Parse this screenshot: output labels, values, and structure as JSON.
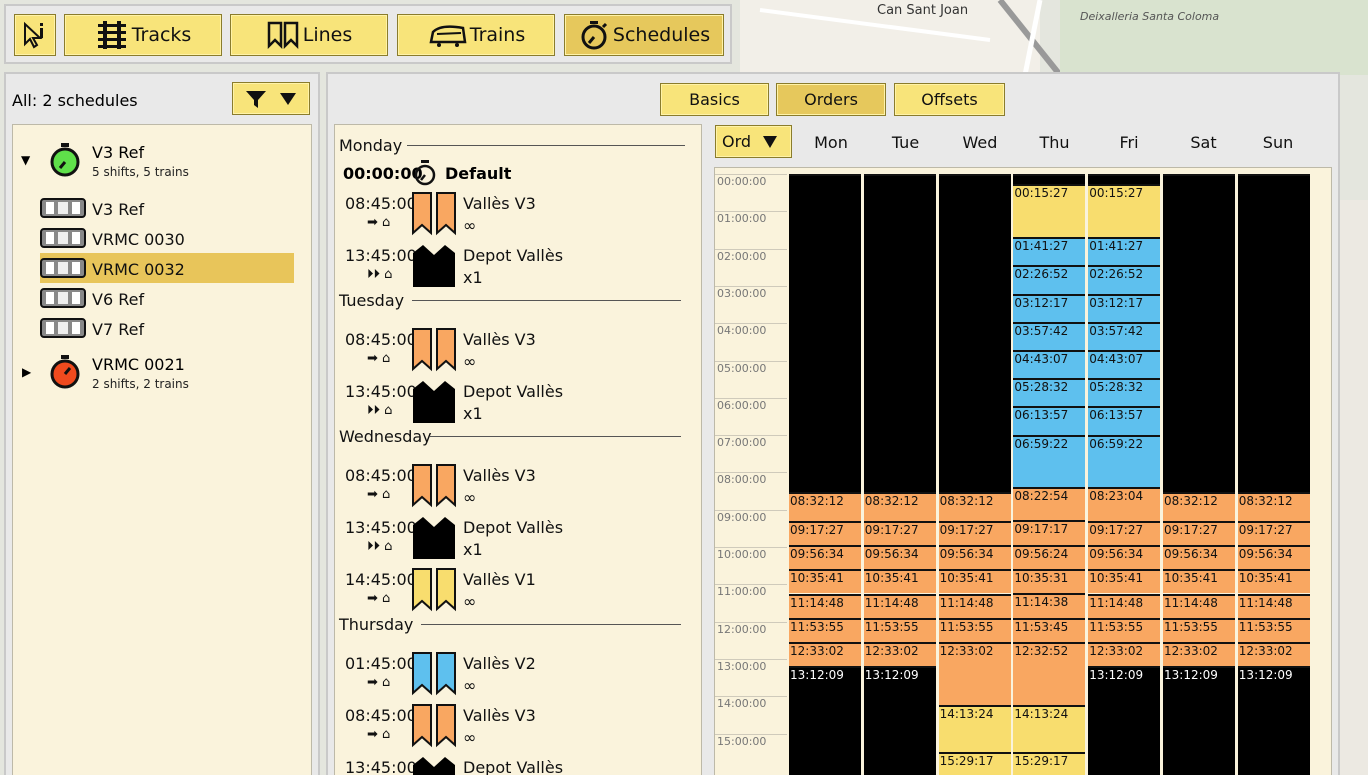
{
  "map": {
    "labels": [
      "Can Sant Joan",
      "Deixalleria Santa Coloma"
    ]
  },
  "toolbar": {
    "tabs": [
      {
        "label": "Tracks",
        "icon": "tracks-icon"
      },
      {
        "label": "Lines",
        "icon": "lines-icon"
      },
      {
        "label": "Trains",
        "icon": "trains-icon"
      },
      {
        "label": "Schedules",
        "icon": "stopwatch-icon"
      }
    ],
    "active": "Schedules"
  },
  "left": {
    "title": "All: 2 schedules",
    "schedules": [
      {
        "name": "V3 Ref",
        "subtitle": "5 shifts, 5 trains",
        "expanded": true,
        "color": "#5fe04a",
        "trains": [
          "V3 Ref",
          "VRMC 0030",
          "VRMC 0032",
          "V6 Ref",
          "V7 Ref"
        ],
        "selected": "VRMC 0032"
      },
      {
        "name": "VRMC 0021",
        "subtitle": "2 shifts, 2 trains",
        "expanded": false,
        "color": "#f04a1e"
      }
    ]
  },
  "subtabs": [
    "Basics",
    "Orders",
    "Offsets"
  ],
  "active_subtab": "Orders",
  "orders": {
    "default": {
      "time": "00:00:00",
      "label": "Default"
    },
    "days": [
      {
        "day": "Monday",
        "items": [
          {
            "time": "08:45:00",
            "name": "Vallès V3",
            "sub": "∞",
            "color": "#f9a761",
            "kind": "line"
          },
          {
            "time": "13:45:00",
            "name": "Depot Vallès",
            "sub": "x1",
            "color": "#000000",
            "kind": "depot"
          }
        ]
      },
      {
        "day": "Tuesday",
        "items": [
          {
            "time": "08:45:00",
            "name": "Vallès V3",
            "sub": "∞",
            "color": "#f9a761",
            "kind": "line"
          },
          {
            "time": "13:45:00",
            "name": "Depot Vallès",
            "sub": "x1",
            "color": "#000000",
            "kind": "depot"
          }
        ]
      },
      {
        "day": "Wednesday",
        "items": [
          {
            "time": "08:45:00",
            "name": "Vallès V3",
            "sub": "∞",
            "color": "#f9a761",
            "kind": "line"
          },
          {
            "time": "13:45:00",
            "name": "Depot Vallès",
            "sub": "x1",
            "color": "#000000",
            "kind": "depot"
          },
          {
            "time": "14:45:00",
            "name": "Vallès V1",
            "sub": "∞",
            "color": "#f8dd6e",
            "kind": "line"
          }
        ]
      },
      {
        "day": "Thursday",
        "items": [
          {
            "time": "01:45:00",
            "name": "Vallès V2",
            "sub": "∞",
            "color": "#5ec0ee",
            "kind": "line"
          },
          {
            "time": "08:45:00",
            "name": "Vallès V3",
            "sub": "∞",
            "color": "#f9a761",
            "kind": "line"
          },
          {
            "time": "13:45:00",
            "name": "Depot Vallès",
            "sub": "",
            "color": "#000000",
            "kind": "depot"
          }
        ]
      }
    ]
  },
  "timeline": {
    "ord_label": "Ord",
    "days": [
      "Mon",
      "Tue",
      "Wed",
      "Thu",
      "Fri",
      "Sat",
      "Sun"
    ],
    "hours": [
      "00:00:00",
      "01:00:00",
      "02:00:00",
      "03:00:00",
      "04:00:00",
      "05:00:00",
      "06:00:00",
      "07:00:00",
      "08:00:00",
      "09:00:00",
      "10:00:00",
      "11:00:00",
      "12:00:00",
      "13:00:00",
      "14:00:00",
      "15:00:00"
    ],
    "columns": [
      {
        "blocks": [
          [
            "",
            "blk"
          ],
          [
            "08:32:12",
            "org"
          ],
          [
            "09:17:27",
            "org"
          ],
          [
            "09:56:34",
            "org"
          ],
          [
            "10:35:41",
            "org"
          ],
          [
            "11:14:48",
            "org"
          ],
          [
            "11:53:55",
            "org"
          ],
          [
            "12:33:02",
            "org"
          ],
          [
            "13:12:09",
            "blk"
          ]
        ]
      },
      {
        "blocks": [
          [
            "",
            "blk"
          ],
          [
            "08:32:12",
            "org"
          ],
          [
            "09:17:27",
            "org"
          ],
          [
            "09:56:34",
            "org"
          ],
          [
            "10:35:41",
            "org"
          ],
          [
            "11:14:48",
            "org"
          ],
          [
            "11:53:55",
            "org"
          ],
          [
            "12:33:02",
            "org"
          ],
          [
            "13:12:09",
            "blk"
          ]
        ]
      },
      {
        "blocks": [
          [
            "",
            "blk"
          ],
          [
            "08:32:12",
            "org"
          ],
          [
            "09:17:27",
            "org"
          ],
          [
            "09:56:34",
            "org"
          ],
          [
            "10:35:41",
            "org"
          ],
          [
            "11:14:48",
            "org"
          ],
          [
            "11:53:55",
            "org"
          ],
          [
            "12:33:02",
            "org"
          ],
          [
            "14:13:24",
            "yel"
          ],
          [
            "15:29:17",
            "yel"
          ]
        ]
      },
      {
        "blocks": [
          [
            "",
            "blk"
          ],
          [
            "00:15:27",
            "yel"
          ],
          [
            "01:41:27",
            "blu"
          ],
          [
            "02:26:52",
            "blu"
          ],
          [
            "03:12:17",
            "blu"
          ],
          [
            "03:57:42",
            "blu"
          ],
          [
            "04:43:07",
            "blu"
          ],
          [
            "05:28:32",
            "blu"
          ],
          [
            "06:13:57",
            "blu"
          ],
          [
            "06:59:22",
            "blu"
          ],
          [
            "08:22:54",
            "org"
          ],
          [
            "09:17:17",
            "org"
          ],
          [
            "09:56:24",
            "org"
          ],
          [
            "10:35:31",
            "org"
          ],
          [
            "11:14:38",
            "org"
          ],
          [
            "11:53:45",
            "org"
          ],
          [
            "12:32:52",
            "org"
          ],
          [
            "14:13:24",
            "yel"
          ],
          [
            "15:29:17",
            "yel"
          ]
        ]
      },
      {
        "blocks": [
          [
            "",
            "blk"
          ],
          [
            "00:15:27",
            "yel"
          ],
          [
            "01:41:27",
            "blu"
          ],
          [
            "02:26:52",
            "blu"
          ],
          [
            "03:12:17",
            "blu"
          ],
          [
            "03:57:42",
            "blu"
          ],
          [
            "04:43:07",
            "blu"
          ],
          [
            "05:28:32",
            "blu"
          ],
          [
            "06:13:57",
            "blu"
          ],
          [
            "06:59:22",
            "blu"
          ],
          [
            "08:23:04",
            "org"
          ],
          [
            "09:17:27",
            "org"
          ],
          [
            "09:56:34",
            "org"
          ],
          [
            "10:35:41",
            "org"
          ],
          [
            "11:14:48",
            "org"
          ],
          [
            "11:53:55",
            "org"
          ],
          [
            "12:33:02",
            "org"
          ],
          [
            "13:12:09",
            "blk"
          ]
        ]
      },
      {
        "blocks": [
          [
            "",
            "blk"
          ],
          [
            "08:32:12",
            "org"
          ],
          [
            "09:17:27",
            "org"
          ],
          [
            "09:56:34",
            "org"
          ],
          [
            "10:35:41",
            "org"
          ],
          [
            "11:14:48",
            "org"
          ],
          [
            "11:53:55",
            "org"
          ],
          [
            "12:33:02",
            "org"
          ],
          [
            "13:12:09",
            "blk"
          ]
        ]
      },
      {
        "blocks": [
          [
            "",
            "blk"
          ],
          [
            "08:32:12",
            "org"
          ],
          [
            "09:17:27",
            "org"
          ],
          [
            "09:56:34",
            "org"
          ],
          [
            "10:35:41",
            "org"
          ],
          [
            "11:14:48",
            "org"
          ],
          [
            "11:53:55",
            "org"
          ],
          [
            "12:33:02",
            "org"
          ],
          [
            "13:12:09",
            "blk"
          ]
        ]
      }
    ]
  }
}
